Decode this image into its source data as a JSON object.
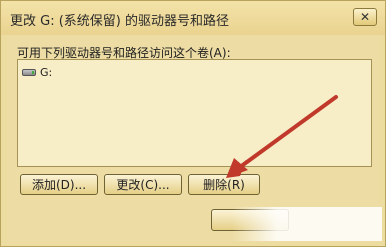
{
  "window": {
    "title": "更改 G: (系统保留) 的驱动器号和路径",
    "close_glyph": "✕"
  },
  "content": {
    "description": "可用下列驱动器号和路径访问这个卷(A):",
    "list": {
      "items": [
        {
          "label": "G:",
          "icon": "drive-icon"
        }
      ]
    }
  },
  "buttons": {
    "add": "添加(D)...",
    "change": "更改(C)...",
    "delete": "删除(R)",
    "ok": ""
  },
  "annotation": {
    "arrow_color": "#c0392b"
  }
}
